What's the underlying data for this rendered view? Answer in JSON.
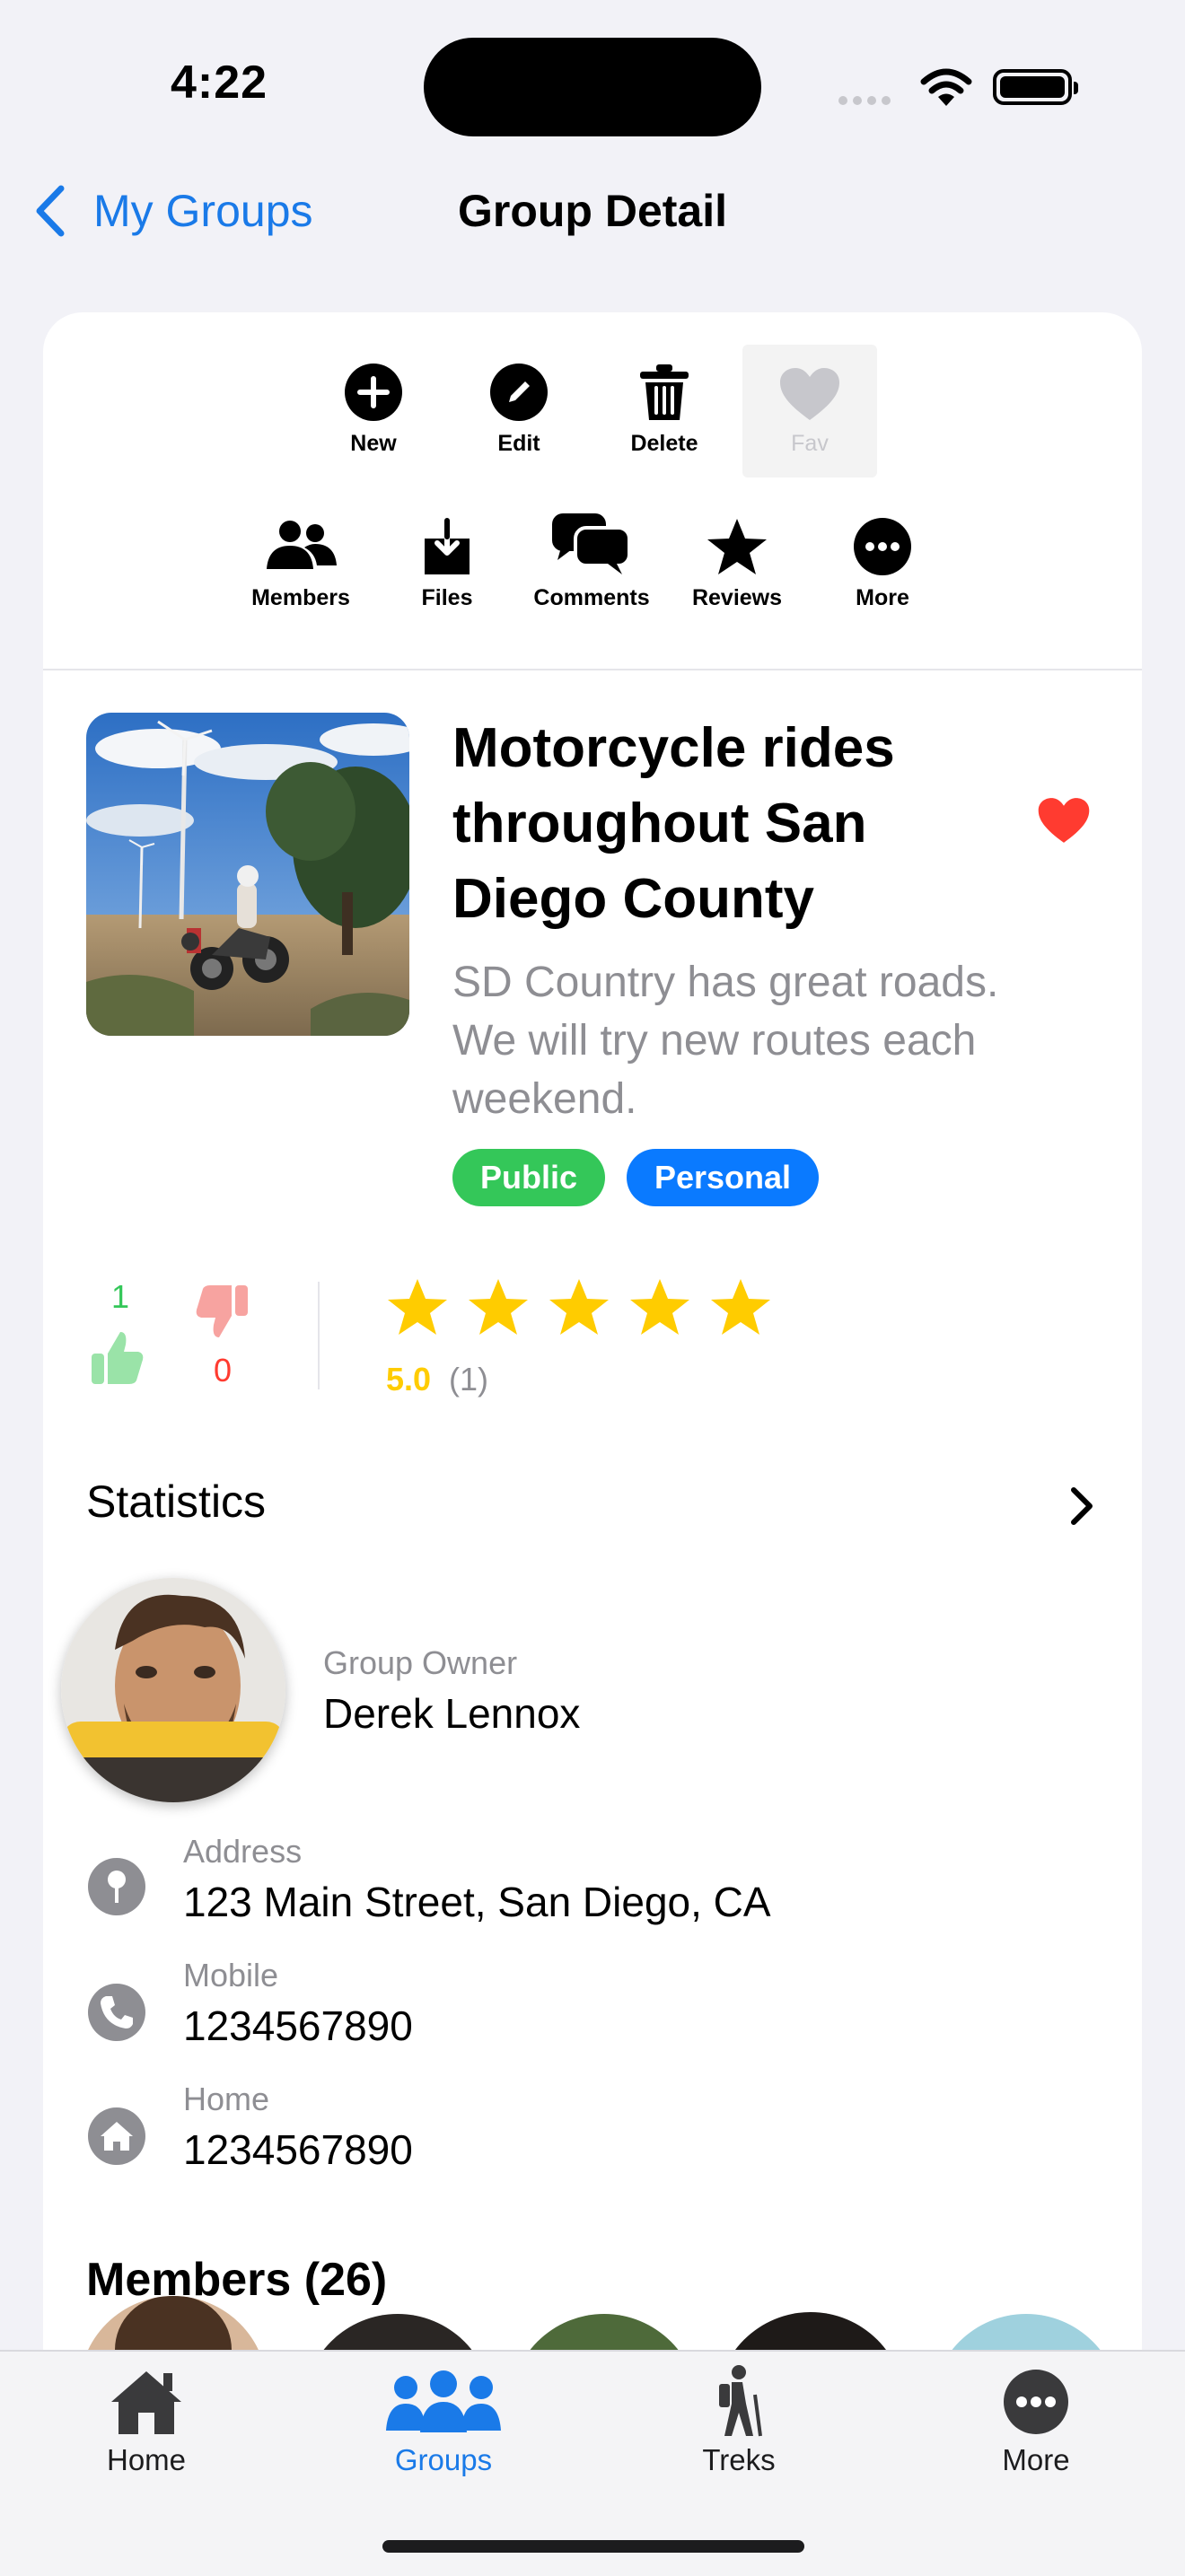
{
  "status": {
    "time": "4:22"
  },
  "nav": {
    "back_label": "My Groups",
    "title": "Group Detail"
  },
  "toolbar": {
    "row1": [
      {
        "label": "New",
        "icon": "plus-circle-icon"
      },
      {
        "label": "Edit",
        "icon": "pencil-circle-icon"
      },
      {
        "label": "Delete",
        "icon": "trash-icon"
      },
      {
        "label": "Fav",
        "icon": "heart-icon",
        "disabled": true
      }
    ],
    "row2": [
      {
        "label": "Members",
        "icon": "people-icon"
      },
      {
        "label": "Files",
        "icon": "download-tray-icon"
      },
      {
        "label": "Comments",
        "icon": "speech-bubbles-icon"
      },
      {
        "label": "Reviews",
        "icon": "star-icon"
      },
      {
        "label": "More",
        "icon": "ellipsis-circle-icon"
      }
    ]
  },
  "group": {
    "title_lines": [
      "Motorcycle rides",
      "throughout San",
      "Diego County"
    ],
    "description_lines": [
      "SD Country has great roads.",
      "We will try new routes each",
      "weekend."
    ],
    "favorite": true,
    "tags": [
      {
        "label": "Public",
        "color": "#34c759"
      },
      {
        "label": "Personal",
        "color": "#0a7aff"
      }
    ]
  },
  "votes": {
    "up": "1",
    "down": "0",
    "up_color": "#34c759",
    "down_color": "#ff3b30"
  },
  "rating": {
    "stars": 5,
    "score": "5.0",
    "count": "(1)",
    "star_color": "#ffcc00"
  },
  "statistics": {
    "title": "Statistics"
  },
  "owner": {
    "label": "Group Owner",
    "name": "Derek Lennox"
  },
  "contact": {
    "address": {
      "label": "Address",
      "value": "123 Main Street, San Diego, CA",
      "icon": "pin-icon"
    },
    "mobile": {
      "label": "Mobile",
      "value": "1234567890",
      "icon": "phone-icon"
    },
    "home": {
      "label": "Home",
      "value": "1234567890",
      "icon": "house-icon"
    }
  },
  "members": {
    "title": "Members (26)"
  },
  "tabs": [
    {
      "label": "Home",
      "icon": "house-tab-icon",
      "active": false
    },
    {
      "label": "Groups",
      "icon": "groups-tab-icon",
      "active": true
    },
    {
      "label": "Treks",
      "icon": "hiker-tab-icon",
      "active": false
    },
    {
      "label": "More",
      "icon": "more-tab-icon",
      "active": false
    }
  ],
  "colors": {
    "accent": "#1a7ae8",
    "secondary_text": "#8e8e93",
    "heart": "#ff3b30"
  }
}
